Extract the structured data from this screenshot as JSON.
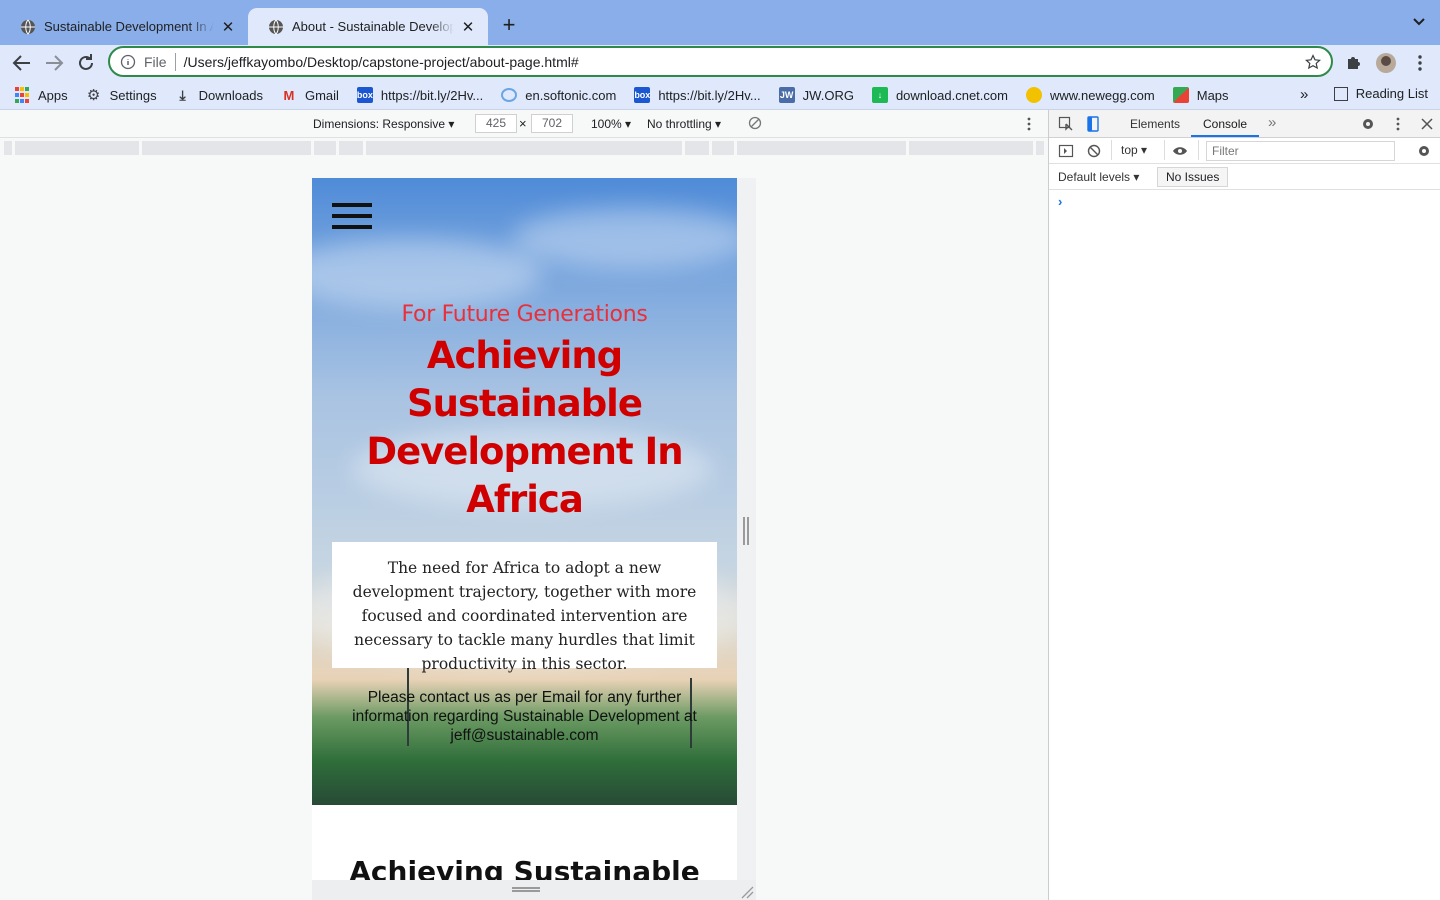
{
  "tabs": [
    {
      "title": "Sustainable Development In Africa",
      "active": false
    },
    {
      "title": "About - Sustainable Development In Africa",
      "active": true
    }
  ],
  "omnibox": {
    "scheme": "File",
    "url": "/Users/jeffkayombo/Desktop/capstone-project/about-page.html#"
  },
  "bookmarks": [
    {
      "label": "Apps",
      "icon": "apps-grid-icon"
    },
    {
      "label": "Settings",
      "icon": "gear-icon"
    },
    {
      "label": "Downloads",
      "icon": "download-icon"
    },
    {
      "label": "Gmail",
      "icon": "gmail-icon"
    },
    {
      "label": "https://bit.ly/2Hv...",
      "icon": "box-icon"
    },
    {
      "label": "en.softonic.com",
      "icon": "softonic-icon"
    },
    {
      "label": "https://bit.ly/2Hv...",
      "icon": "box-icon"
    },
    {
      "label": "JW.ORG",
      "icon": "jw-icon"
    },
    {
      "label": "download.cnet.com",
      "icon": "cnet-icon"
    },
    {
      "label": "www.newegg.com",
      "icon": "newegg-icon"
    },
    {
      "label": "Maps",
      "icon": "maps-icon"
    }
  ],
  "reading_list": "Reading List",
  "device_toolbar": {
    "dimensions": "Dimensions: Responsive",
    "width": "425",
    "height": "702",
    "times": "×",
    "zoom": "100%",
    "throttling": "No throttling"
  },
  "page": {
    "subtitle": "For Future Generations",
    "headline": "Achieving Sustainable Development In Africa",
    "card_text": "The need for Africa to adopt a new development trajectory, together with more focused and coordinated intervention are necessary to tackle many hurdles that limit productivity in this sector.",
    "contact_text": "Please contact us as per Email for any further information regarding Sustainable Development at jeff@sustainable.com",
    "next_heading": "Achieving Sustainable"
  },
  "devtools": {
    "tabs": [
      "Elements",
      "Console"
    ],
    "active_tab": "Console",
    "context": "top",
    "filter_placeholder": "Filter",
    "levels": "Default levels",
    "issues": "No Issues",
    "prompt": "›"
  },
  "colors": {
    "tabstrip": "#8aaeea",
    "toolbar": "#dfe9fb",
    "omnibox_border": "#2f8a49",
    "headline_red": "#d10000",
    "subtitle_red": "#e9303a",
    "devtools_accent": "#1a73e8"
  }
}
